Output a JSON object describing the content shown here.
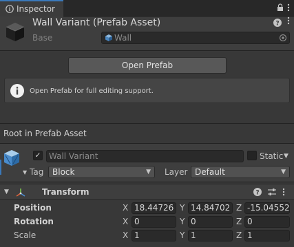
{
  "tab": {
    "label": "Inspector",
    "icon": "info-icon"
  },
  "tab_buttons": {
    "lock": "lock-icon",
    "menu": "kebab-menu-icon"
  },
  "header": {
    "title": "Wall Variant (Prefab Asset)",
    "base_label": "Base",
    "base_value": "Wall",
    "help_icon": "help-icon",
    "menu_icon": "kebab-menu-icon"
  },
  "open_prefab": {
    "label": "Open Prefab"
  },
  "info_box": {
    "text": "Open Prefab for full editing support."
  },
  "section": {
    "label": "Root in Prefab Asset"
  },
  "gameobject": {
    "active": true,
    "name": "Wall Variant",
    "static_label": "Static",
    "static_checked": false,
    "tag_label": "Tag",
    "tag_value": "Block",
    "layer_label": "Layer",
    "layer_value": "Default"
  },
  "transform": {
    "title": "Transform",
    "rows": [
      {
        "label": "Position",
        "bold": true,
        "x": "18.44726",
        "y": "14.84702",
        "z": "-15.04552"
      },
      {
        "label": "Rotation",
        "bold": true,
        "x": "0",
        "y": "0",
        "z": "0"
      },
      {
        "label": "Scale",
        "bold": false,
        "x": "1",
        "y": "1",
        "z": "1"
      }
    ],
    "axes": [
      "X",
      "Y",
      "Z"
    ]
  },
  "colors": {
    "accent": "#3a79bb",
    "panel": "#383838",
    "header": "#3e3e3e",
    "field": "#2a2a2a",
    "button": "#585858"
  }
}
